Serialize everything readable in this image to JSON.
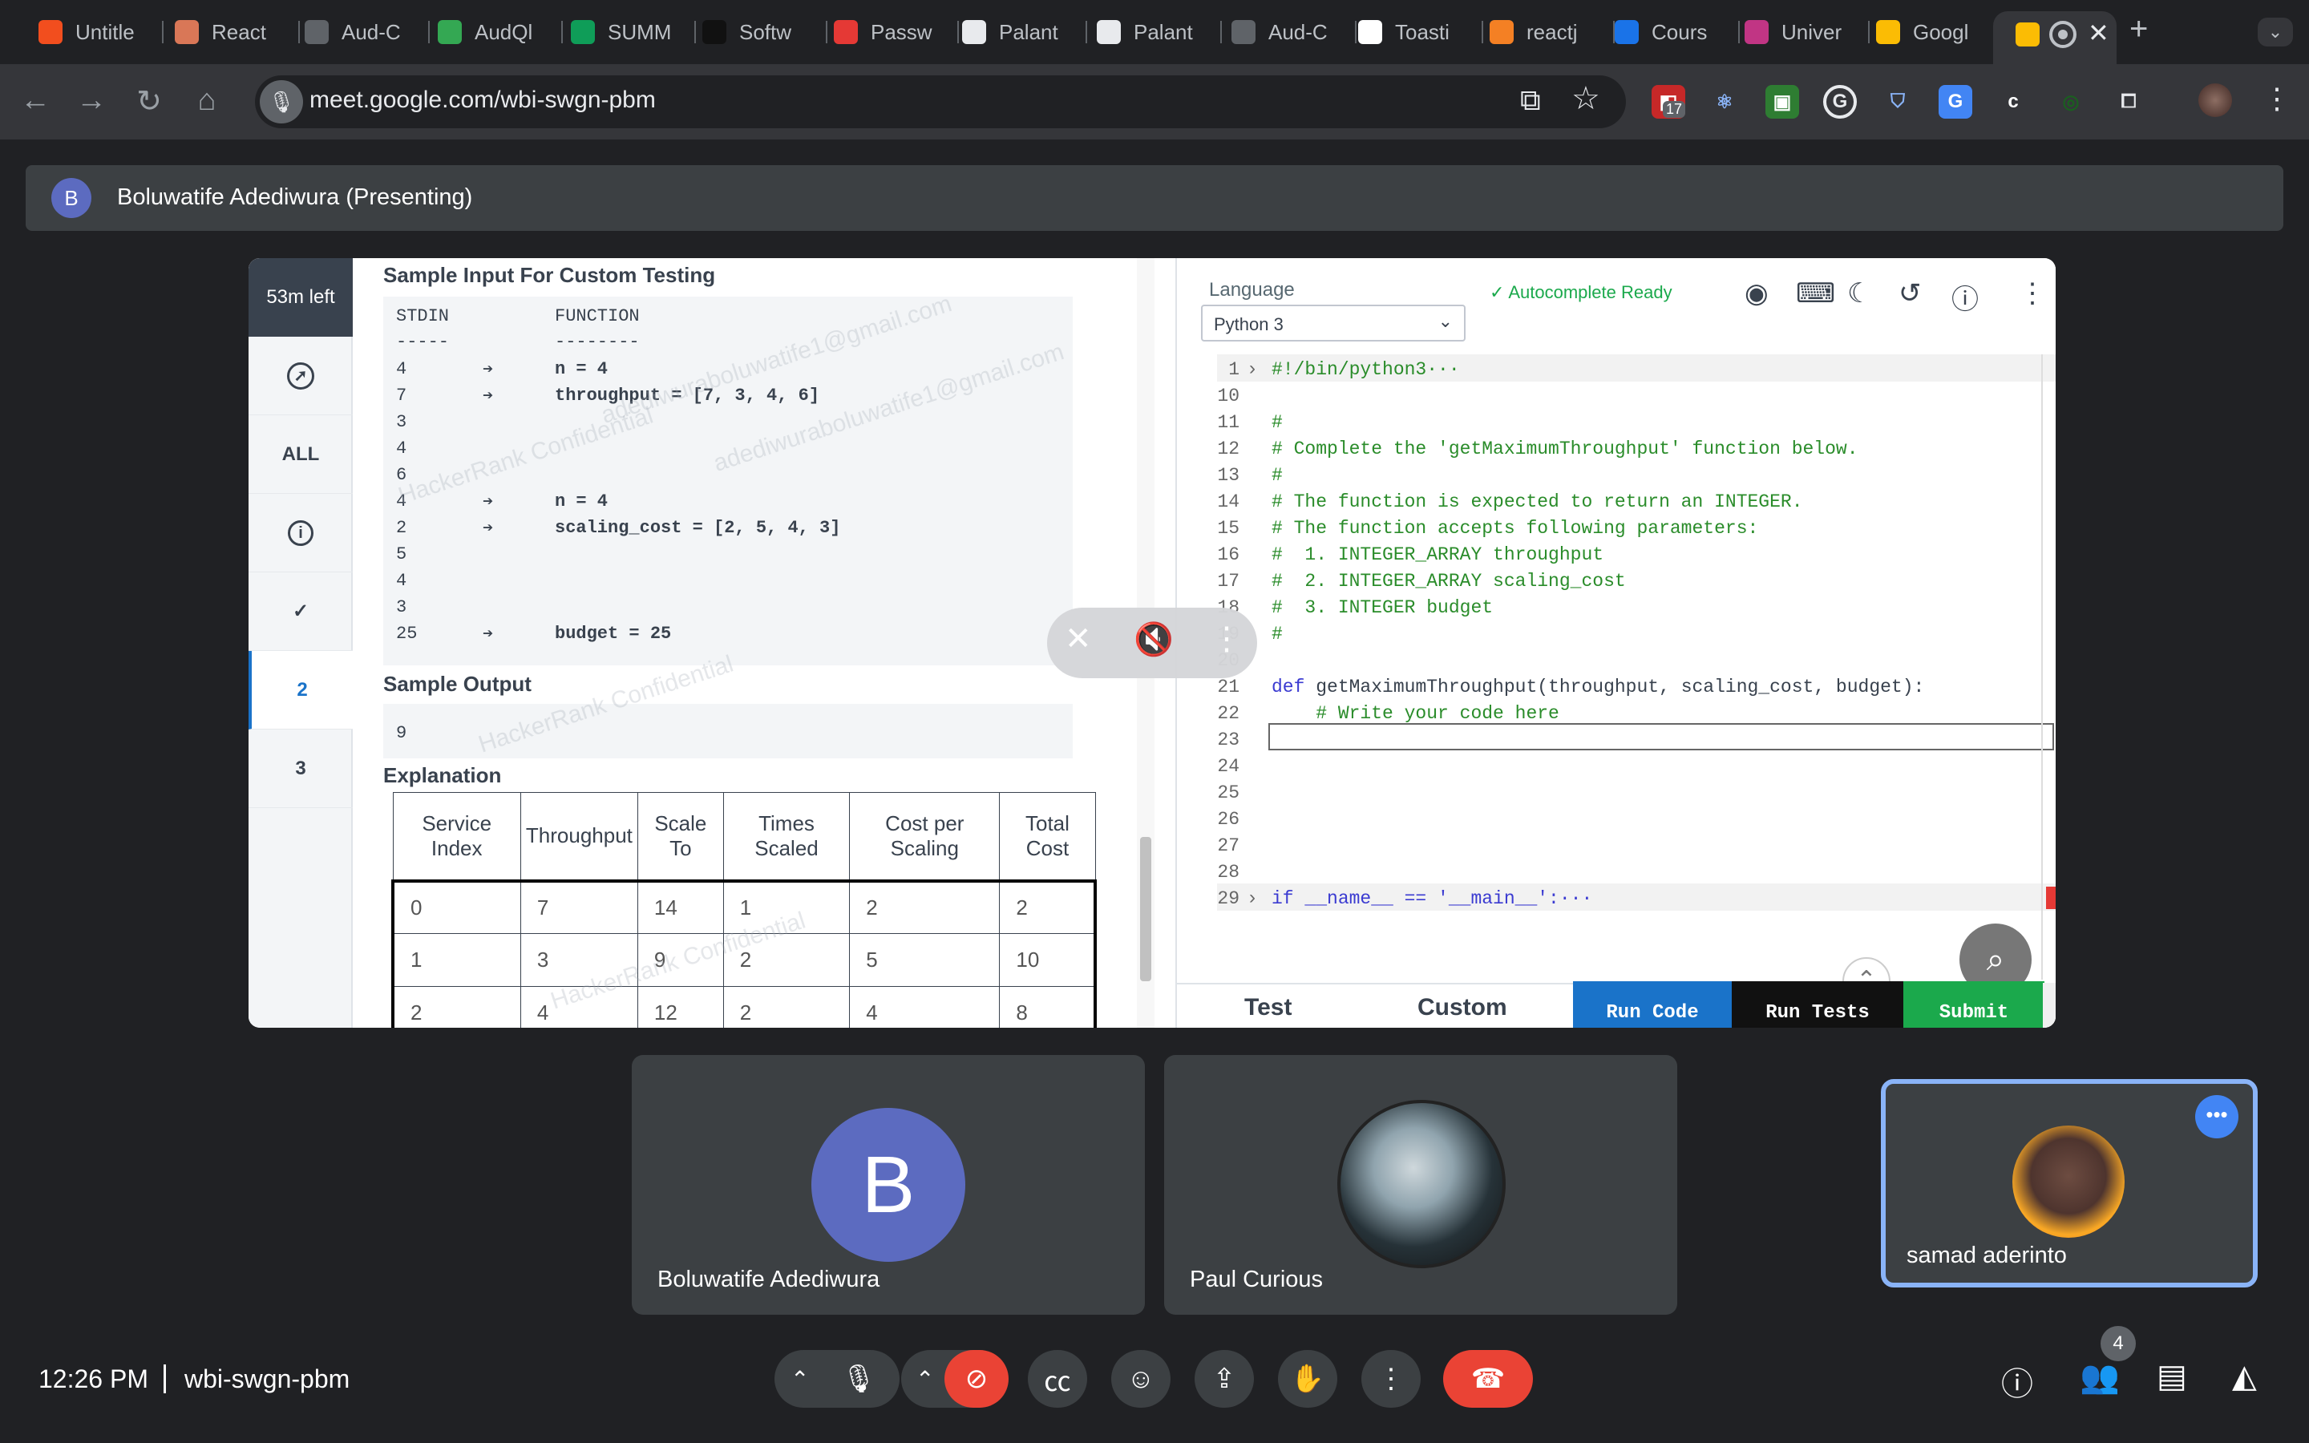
{
  "browser": {
    "tabs": [
      {
        "label": "Untitle",
        "icon": "figma-icon",
        "color": "#f24e1e"
      },
      {
        "label": "React",
        "icon": "claude-icon",
        "color": "#d97757"
      },
      {
        "label": "Aud-C",
        "icon": "diamond-icon",
        "color": "#5f6368"
      },
      {
        "label": "AudQl",
        "icon": "graphql-icon",
        "color": "#34a853"
      },
      {
        "label": "SUMM",
        "icon": "sheets-icon",
        "color": "#0f9d58"
      },
      {
        "label": "Softw",
        "icon": "chatgpt-icon",
        "color": "#111111"
      },
      {
        "label": "Passw",
        "icon": "opera-icon",
        "color": "#e53935"
      },
      {
        "label": "Palant",
        "icon": "palantir-icon",
        "color": "#e8eaed"
      },
      {
        "label": "Palant",
        "icon": "palantir-icon",
        "color": "#e8eaed"
      },
      {
        "label": "Aud-C",
        "icon": "diamond-icon",
        "color": "#5f6368"
      },
      {
        "label": "Toasti",
        "icon": "openai-icon",
        "color": "#ffffff"
      },
      {
        "label": "reactj",
        "icon": "stackoverflow-icon",
        "color": "#f48024"
      },
      {
        "label": "Cours",
        "icon": "coursera-icon",
        "color": "#1a73e8"
      },
      {
        "label": "Univer",
        "icon": "instagram-icon",
        "color": "#c13584"
      },
      {
        "label": "Googl",
        "icon": "meet-icon",
        "color": "#fbbc04"
      }
    ],
    "url": "meet.google.com/wbi-swgn-pbm",
    "extension_badge": "17"
  },
  "presenting_bar": {
    "initial": "B",
    "text": "Boluwatife Adediwura (Presenting)"
  },
  "hackerrank": {
    "timer": "53m left",
    "side_items": [
      "ALL",
      "2",
      "3"
    ],
    "sample_input_heading": "Sample Input For Custom Testing",
    "stdin_header": "STDIN",
    "function_header": "FUNCTION",
    "dashes_left": "-----",
    "dashes_right": "--------",
    "stdin_lines": [
      "4",
      "7",
      "3",
      "4",
      "6",
      "4",
      "2",
      "5",
      "4",
      "3",
      "25"
    ],
    "function_lines": [
      {
        "row": 0,
        "text": "n = 4"
      },
      {
        "row": 1,
        "text": "throughput = [7, 3, 4, 6]"
      },
      {
        "row": 5,
        "text": "n = 4"
      },
      {
        "row": 6,
        "text": "scaling_cost = [2, 5, 4, 3]"
      },
      {
        "row": 10,
        "text": "budget = 25"
      }
    ],
    "sample_output_heading": "Sample Output",
    "sample_output": "9",
    "explanation_heading": "Explanation",
    "table_headers": [
      "Service Index",
      "Throughput",
      "Scale To",
      "Times Scaled",
      "Cost per Scaling",
      "Total Cost"
    ],
    "table_rows": [
      [
        "0",
        "7",
        "14",
        "1",
        "2",
        "2"
      ],
      [
        "1",
        "3",
        "9",
        "2",
        "5",
        "10"
      ],
      [
        "2",
        "4",
        "12",
        "2",
        "4",
        "8"
      ]
    ],
    "watermarks": [
      "HackerRank Confidential",
      "adediwuraboluwatife1@gmail.com",
      "HackerRank Confidential",
      "adediwuraboluwatife1@gmail.com",
      "HackerRank Confidential"
    ]
  },
  "editor": {
    "language_label": "Language",
    "language": "Python 3",
    "autocomplete": "Autocomplete Ready",
    "lines": [
      {
        "n": "1",
        "text": "#!/bin/python3···",
        "cls": "cm",
        "fold": true
      },
      {
        "n": "10",
        "text": "",
        "cls": ""
      },
      {
        "n": "11",
        "text": "#",
        "cls": "cm"
      },
      {
        "n": "12",
        "text": "# Complete the 'getMaximumThroughput' function below.",
        "cls": "cm"
      },
      {
        "n": "13",
        "text": "#",
        "cls": "cm"
      },
      {
        "n": "14",
        "text": "# The function is expected to return an INTEGER.",
        "cls": "cm"
      },
      {
        "n": "15",
        "text": "# The function accepts following parameters:",
        "cls": "cm"
      },
      {
        "n": "16",
        "text": "#  1. INTEGER_ARRAY throughput",
        "cls": "cm"
      },
      {
        "n": "17",
        "text": "#  2. INTEGER_ARRAY scaling_cost",
        "cls": "cm"
      },
      {
        "n": "18",
        "text": "#  3. INTEGER budget",
        "cls": "cm"
      },
      {
        "n": "19",
        "text": "#",
        "cls": "cm"
      },
      {
        "n": "20",
        "text": "",
        "cls": ""
      },
      {
        "n": "21",
        "text": "def getMaximumThroughput(throughput, scaling_cost, budget):",
        "cls": "def"
      },
      {
        "n": "22",
        "text": "    # Write your code here",
        "cls": "cm"
      },
      {
        "n": "23",
        "text": "",
        "cls": ""
      },
      {
        "n": "24",
        "text": "",
        "cls": ""
      },
      {
        "n": "25",
        "text": "",
        "cls": ""
      },
      {
        "n": "26",
        "text": "",
        "cls": ""
      },
      {
        "n": "27",
        "text": "",
        "cls": ""
      },
      {
        "n": "28",
        "text": "",
        "cls": ""
      },
      {
        "n": "29",
        "text": "if __name__ == '__main__':···",
        "cls": "kw",
        "fold": true
      }
    ],
    "bottom_tabs": [
      "Test",
      "Custom"
    ],
    "buttons": [
      {
        "label": "Run Code",
        "color": "#1a73c9"
      },
      {
        "label": "Run Tests",
        "color": "#111111"
      },
      {
        "label": "Submit",
        "color": "#1ba94c"
      }
    ]
  },
  "participants": [
    {
      "name": "Boluwatife Adediwura",
      "initial": "B"
    },
    {
      "name": "Paul Curious"
    },
    {
      "name": "samad aderinto"
    }
  ],
  "bottom_bar": {
    "time": "12:26 PM",
    "meeting_code": "wbi-swgn-pbm",
    "participant_count": "4"
  },
  "colors": {
    "hangup": "#ea4335",
    "cam_off": "#ea4335",
    "accent": "#8ab4f8"
  }
}
